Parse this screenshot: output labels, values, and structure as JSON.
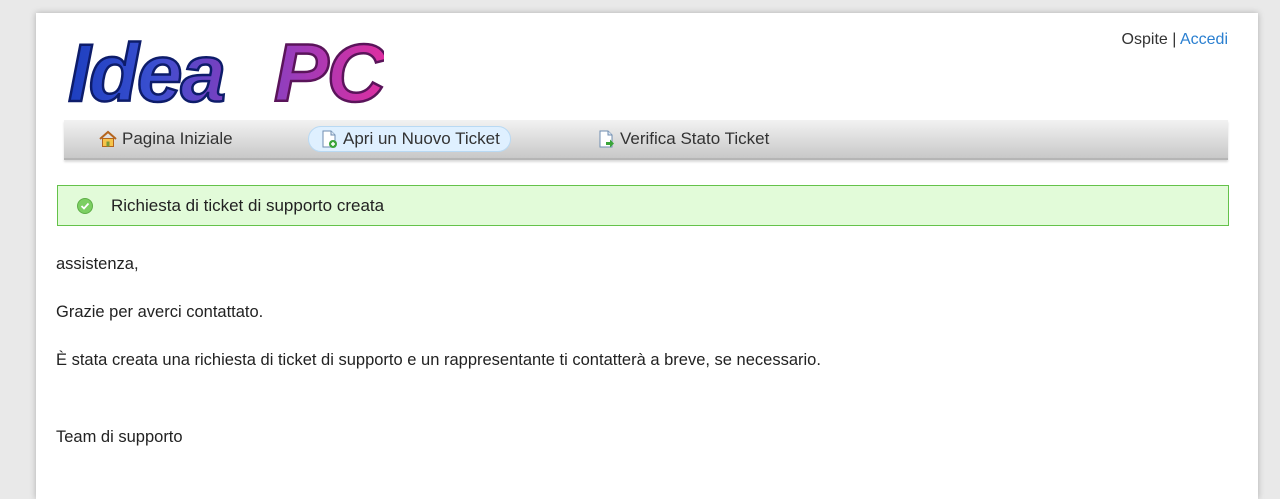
{
  "header": {
    "logo_text": "Idea PC",
    "user": {
      "guest_label": "Ospite",
      "separator": "|",
      "login_link": "Accedi"
    }
  },
  "nav": {
    "items": [
      {
        "label": "Pagina Iniziale",
        "icon": "home-icon",
        "active": false
      },
      {
        "label": "Apri un Nuovo Ticket",
        "icon": "new-ticket-icon",
        "active": true
      },
      {
        "label": "Verifica Stato Ticket",
        "icon": "ticket-status-icon",
        "active": false
      }
    ]
  },
  "alert": {
    "icon": "check-circle-icon",
    "message": "Richiesta di ticket di supporto creata",
    "color": "#e2fbd9",
    "border_color": "#64c24a"
  },
  "body": {
    "greeting": "assistenza,",
    "thanks": "Grazie per averci contattato.",
    "message": "È stata creata una richiesta di ticket di supporto e un rappresentante ti contatterà a breve, se necessario.",
    "signature": "Team di supporto"
  },
  "colors": {
    "link": "#2a7fd0",
    "logo_blue": "#2a3fb8",
    "logo_magenta": "#c63aa8"
  }
}
